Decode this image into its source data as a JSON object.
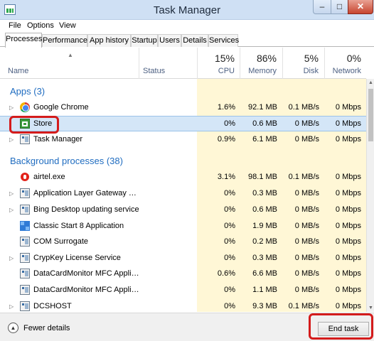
{
  "window": {
    "title": "Task Manager",
    "minimize_glyph": "–",
    "maximize_glyph": "□",
    "close_glyph": "✕"
  },
  "menu": [
    "File",
    "Options",
    "View"
  ],
  "tabs": [
    "Processes",
    "Performance",
    "App history",
    "Startup",
    "Users",
    "Details",
    "Services"
  ],
  "active_tab": "Processes",
  "columns": {
    "name": "Name",
    "status": "Status",
    "cpu": {
      "percent": "15%",
      "label": "CPU"
    },
    "memory": {
      "percent": "86%",
      "label": "Memory"
    },
    "disk": {
      "percent": "5%",
      "label": "Disk"
    },
    "network": {
      "percent": "0%",
      "label": "Network"
    }
  },
  "groups": {
    "apps": "Apps (3)",
    "background": "Background processes (38)"
  },
  "rows": [
    {
      "name": "Google Chrome",
      "cpu": "1.6%",
      "memory": "92.1 MB",
      "disk": "0.1 MB/s",
      "network": "0 Mbps",
      "icon": "chrome-icon"
    },
    {
      "name": "Store",
      "cpu": "0%",
      "memory": "0.6 MB",
      "disk": "0 MB/s",
      "network": "0 Mbps",
      "icon": "store-icon"
    },
    {
      "name": "Task Manager",
      "cpu": "0.9%",
      "memory": "6.1 MB",
      "disk": "0 MB/s",
      "network": "0 Mbps",
      "icon": "task-manager-icon"
    },
    {
      "name": "airtel.exe",
      "cpu": "3.1%",
      "memory": "98.1 MB",
      "disk": "0.1 MB/s",
      "network": "0 Mbps",
      "icon": "airtel-icon"
    },
    {
      "name": "Application Layer Gateway Servi...",
      "cpu": "0%",
      "memory": "0.3 MB",
      "disk": "0 MB/s",
      "network": "0 Mbps",
      "icon": "service-icon"
    },
    {
      "name": "Bing Desktop updating service",
      "cpu": "0%",
      "memory": "0.6 MB",
      "disk": "0 MB/s",
      "network": "0 Mbps",
      "icon": "service-icon"
    },
    {
      "name": "Classic Start 8 Application",
      "cpu": "0%",
      "memory": "1.9 MB",
      "disk": "0 MB/s",
      "network": "0 Mbps",
      "icon": "classic-start-icon"
    },
    {
      "name": "COM Surrogate",
      "cpu": "0%",
      "memory": "0.2 MB",
      "disk": "0 MB/s",
      "network": "0 Mbps",
      "icon": "service-icon"
    },
    {
      "name": "CrypKey License Service",
      "cpu": "0%",
      "memory": "0.3 MB",
      "disk": "0 MB/s",
      "network": "0 Mbps",
      "icon": "service-icon"
    },
    {
      "name": "DataCardMonitor MFC Applicat...",
      "cpu": "0.6%",
      "memory": "6.6 MB",
      "disk": "0 MB/s",
      "network": "0 Mbps",
      "icon": "service-icon"
    },
    {
      "name": "DataCardMonitor MFC Applicat...",
      "cpu": "0%",
      "memory": "1.1 MB",
      "disk": "0 MB/s",
      "network": "0 Mbps",
      "icon": "service-icon"
    },
    {
      "name": "DCSHOST",
      "cpu": "0%",
      "memory": "9.3 MB",
      "disk": "0.1 MB/s",
      "network": "0 Mbps",
      "icon": "service-icon"
    }
  ],
  "selected_row": "Store",
  "footer": {
    "fewer_details": "Fewer details",
    "end_task": "End task"
  }
}
